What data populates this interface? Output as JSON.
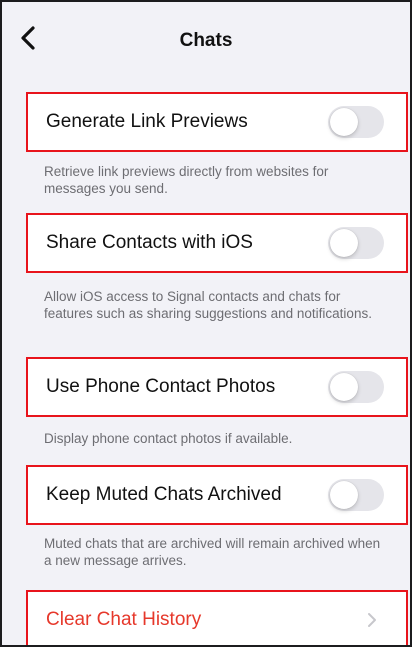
{
  "navbar": {
    "back_icon": "chevron-left-icon",
    "title": "Chats"
  },
  "settings": [
    {
      "label": "Generate Link Previews",
      "enabled": false,
      "footer": "Retrieve link previews directly from websites for messages you send."
    },
    {
      "label": "Share Contacts with iOS",
      "enabled": false,
      "footer": "Allow iOS access to Signal contacts and chats for features such as sharing suggestions and notifications."
    },
    {
      "label": "Use Phone Contact Photos",
      "enabled": false,
      "footer": "Display phone contact photos if available."
    },
    {
      "label": "Keep Muted Chats Archived",
      "enabled": false,
      "footer": "Muted chats that are archived will remain archived when a new message arrives."
    }
  ],
  "clear_history": {
    "label": "Clear Chat History",
    "icon": "chevron-right-icon"
  },
  "colors": {
    "background": "#f2f2f7",
    "highlight": "#e8141c",
    "danger_text": "#e6382b",
    "secondary_text": "#6d6d72",
    "toggle_off": "#e5e5ea"
  }
}
